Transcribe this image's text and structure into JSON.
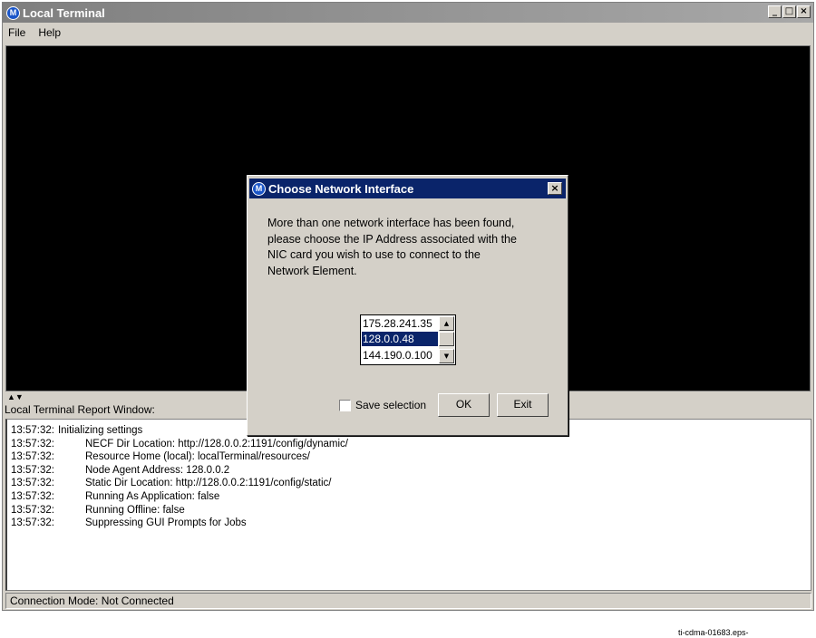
{
  "window": {
    "title": "Local Terminal",
    "logo": "M",
    "controls": {
      "minimize": "_",
      "maximize": "□",
      "close": "×"
    }
  },
  "menu": [
    "File",
    "Help"
  ],
  "splitter_arrows": "▲▼",
  "report": {
    "label": "Local Terminal Report Window:",
    "lines": [
      {
        "time": "13:57:32:",
        "text": "Initializing settings"
      },
      {
        "time": "13:57:32:",
        "text": "NECF Dir Location: http://128.0.0.2:1191/config/dynamic/"
      },
      {
        "time": "13:57:32:",
        "text": "Resource Home (local): localTerminal/resources/"
      },
      {
        "time": "13:57:32:",
        "text": "Node Agent Address: 128.0.0.2"
      },
      {
        "time": "13:57:32:",
        "text": "Static Dir Location: http://128.0.0.2:1191/config/static/"
      },
      {
        "time": "13:57:32:",
        "text": "Running As Application: false"
      },
      {
        "time": "13:57:32:",
        "text": "Running Offline: false"
      },
      {
        "time": "13:57:32:",
        "text": "Suppressing GUI Prompts for Jobs"
      }
    ]
  },
  "status": "Connection Mode: Not Connected",
  "caption": "ti-cdma-01683.eps-",
  "dialog": {
    "title": "Choose Network Interface",
    "close": "×",
    "message_lines": [
      "More than one network interface has been found,",
      "please choose the IP Address associated with the",
      "NIC card you wish to use to connect to the",
      "Network Element."
    ],
    "ip_options": [
      "175.28.241.35",
      "128.0.0.48",
      "144.190.0.100"
    ],
    "selected_index": 1,
    "scroll": {
      "up": "▲",
      "down": "▼"
    },
    "save_selection_label": "Save selection",
    "save_selection_checked": false,
    "ok_label": "OK",
    "exit_label": "Exit"
  },
  "colors": {
    "title_bar_inactive": "#8c8c8c",
    "dialog_title_active": "#0a246a",
    "selection": "#0a246a",
    "terminal_bg": "#000000",
    "chrome": "#d4d0c8"
  }
}
